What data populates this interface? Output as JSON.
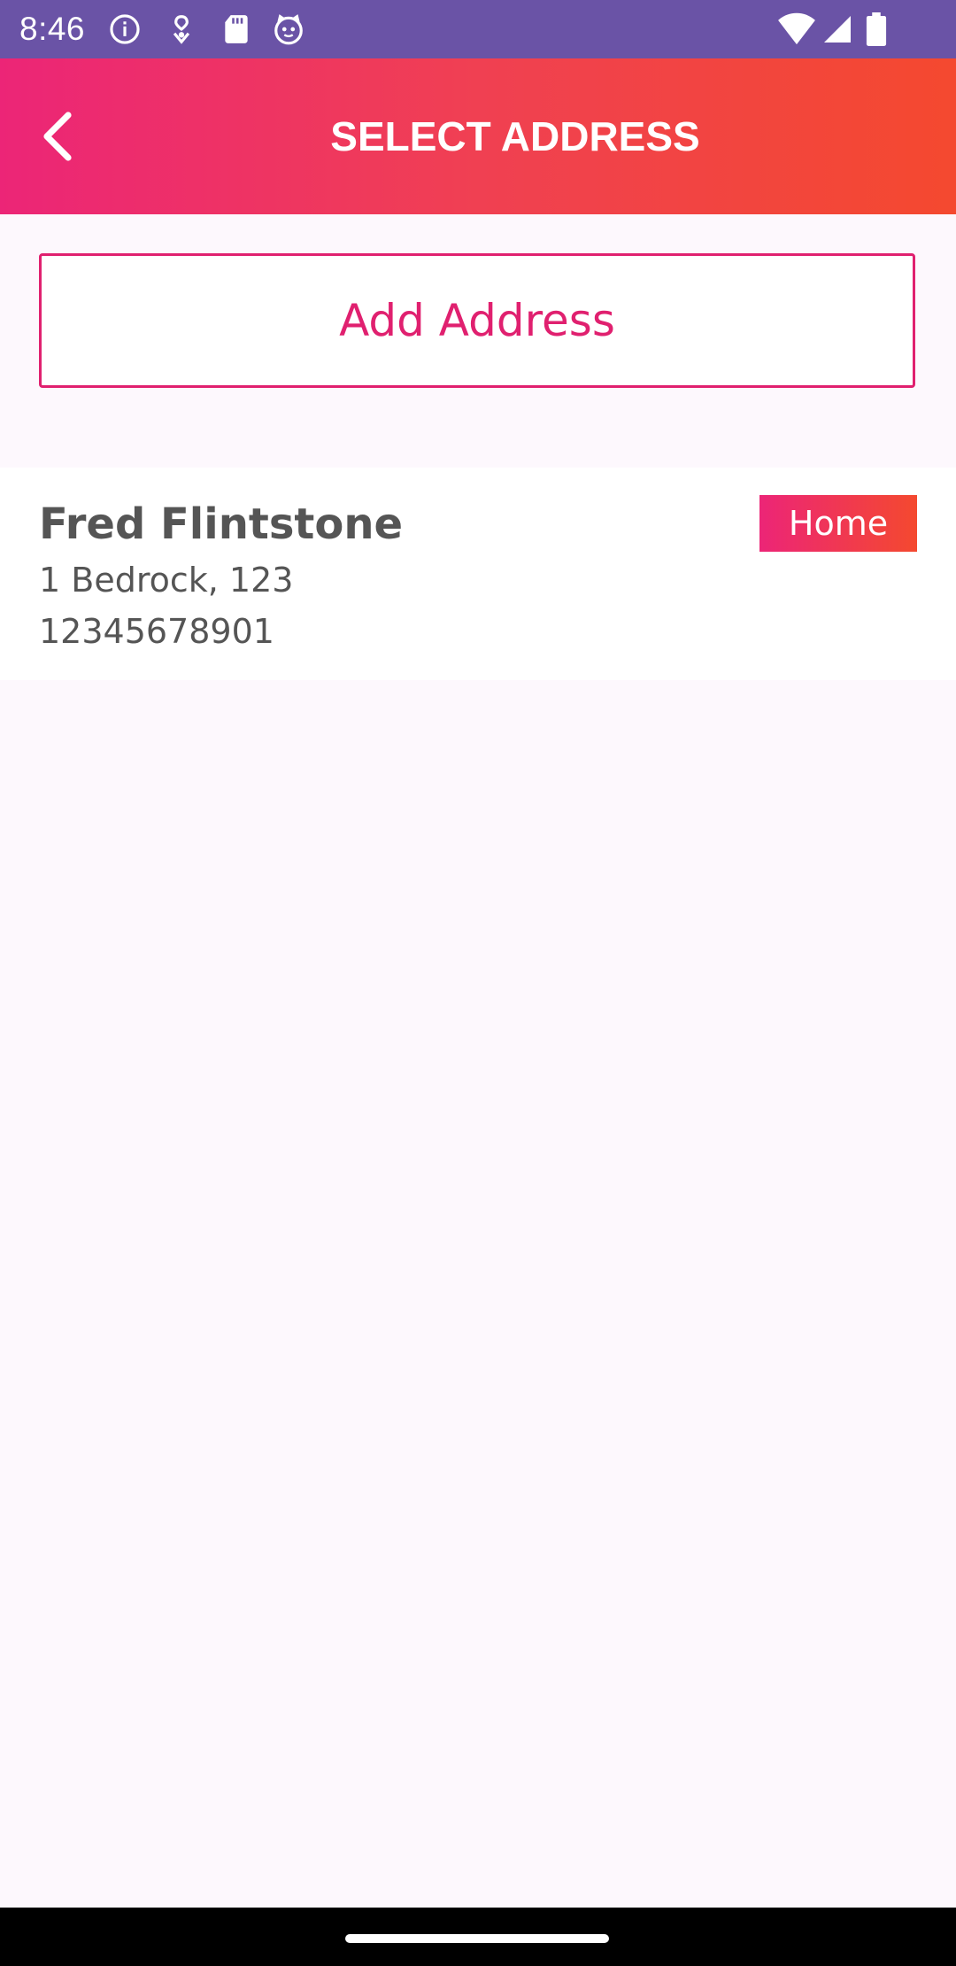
{
  "status_bar": {
    "time": "8:46",
    "left_icons": [
      "info-icon",
      "location-heart-icon",
      "sd-card-icon",
      "cat-face-icon"
    ],
    "right_icons": [
      "wifi-icon",
      "cell-signal-icon",
      "battery-icon"
    ],
    "background_color": "#6a53a6"
  },
  "app_bar": {
    "title": "SELECT ADDRESS",
    "back_icon": "chevron-left-icon",
    "gradient_start": "#ec2577",
    "gradient_end": "#f4492f"
  },
  "actions": {
    "add_address_label": "Add Address",
    "accent_color": "#e0206f"
  },
  "addresses": [
    {
      "name": "Fred Flintstone",
      "address": "1 Bedrock, 123",
      "phone": "12345678901",
      "tag": "Home"
    }
  ]
}
